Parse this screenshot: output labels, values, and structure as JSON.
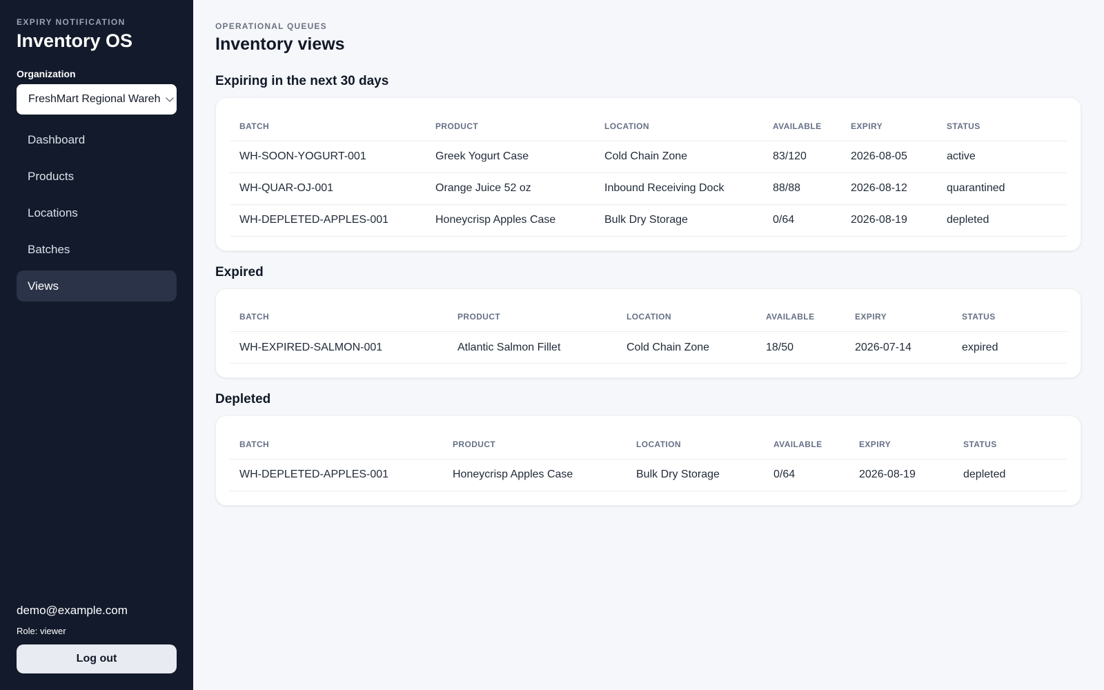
{
  "sidebar": {
    "eyebrow": "EXPIRY NOTIFICATION",
    "brand": "Inventory OS",
    "org_label": "Organization",
    "org_value": "FreshMart Regional Warehouse",
    "nav": [
      {
        "label": "Dashboard",
        "active": false
      },
      {
        "label": "Products",
        "active": false
      },
      {
        "label": "Locations",
        "active": false
      },
      {
        "label": "Batches",
        "active": false
      },
      {
        "label": "Views",
        "active": true
      }
    ],
    "user_email": "demo@example.com",
    "user_role": "Role: viewer",
    "logout_label": "Log out"
  },
  "main": {
    "eyebrow": "OPERATIONAL QUEUES",
    "title": "Inventory views",
    "columns": [
      "BATCH",
      "PRODUCT",
      "LOCATION",
      "AVAILABLE",
      "EXPIRY",
      "STATUS"
    ],
    "sections": [
      {
        "title": "Expiring in the next 30 days",
        "rows": [
          [
            "WH-SOON-YOGURT-001",
            "Greek Yogurt Case",
            "Cold Chain Zone",
            "83/120",
            "2026-08-05",
            "active"
          ],
          [
            "WH-QUAR-OJ-001",
            "Orange Juice 52 oz",
            "Inbound Receiving Dock",
            "88/88",
            "2026-08-12",
            "quarantined"
          ],
          [
            "WH-DEPLETED-APPLES-001",
            "Honeycrisp Apples Case",
            "Bulk Dry Storage",
            "0/64",
            "2026-08-19",
            "depleted"
          ]
        ]
      },
      {
        "title": "Expired",
        "rows": [
          [
            "WH-EXPIRED-SALMON-001",
            "Atlantic Salmon Fillet",
            "Cold Chain Zone",
            "18/50",
            "2026-07-14",
            "expired"
          ]
        ]
      },
      {
        "title": "Depleted",
        "rows": [
          [
            "WH-DEPLETED-APPLES-001",
            "Honeycrisp Apples Case",
            "Bulk Dry Storage",
            "0/64",
            "2026-08-19",
            "depleted"
          ]
        ]
      }
    ]
  }
}
